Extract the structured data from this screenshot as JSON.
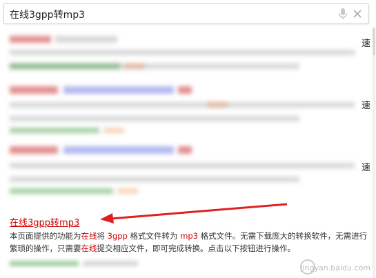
{
  "search": {
    "query": "在线3gpp转mp3"
  },
  "edge_chars": [
    "速",
    "速",
    "速"
  ],
  "result": {
    "title": "在线3gpp转mp3",
    "desc_parts": [
      {
        "text": "本页面提供的功能为",
        "hl": false
      },
      {
        "text": "在线",
        "hl": true
      },
      {
        "text": "将 ",
        "hl": false
      },
      {
        "text": "3gpp",
        "hl": true
      },
      {
        "text": " 格式文件转为 ",
        "hl": false
      },
      {
        "text": "mp3",
        "hl": true
      },
      {
        "text": " 格式文件。无需下载庞大的转换软件，无需进行繁琐的操作，只需要",
        "hl": false
      },
      {
        "text": "在线",
        "hl": true
      },
      {
        "text": "提交相应文件，即可完成转换。点击以下按钮进行操作。",
        "hl": false
      }
    ]
  },
  "watermark": {
    "text": "jingyan.baidu.com"
  },
  "colors": {
    "highlight": "#cc0000",
    "arrow": "#e02020"
  },
  "icons": [
    "mic-icon",
    "clear-icon",
    "watermark-logo-icon"
  ]
}
